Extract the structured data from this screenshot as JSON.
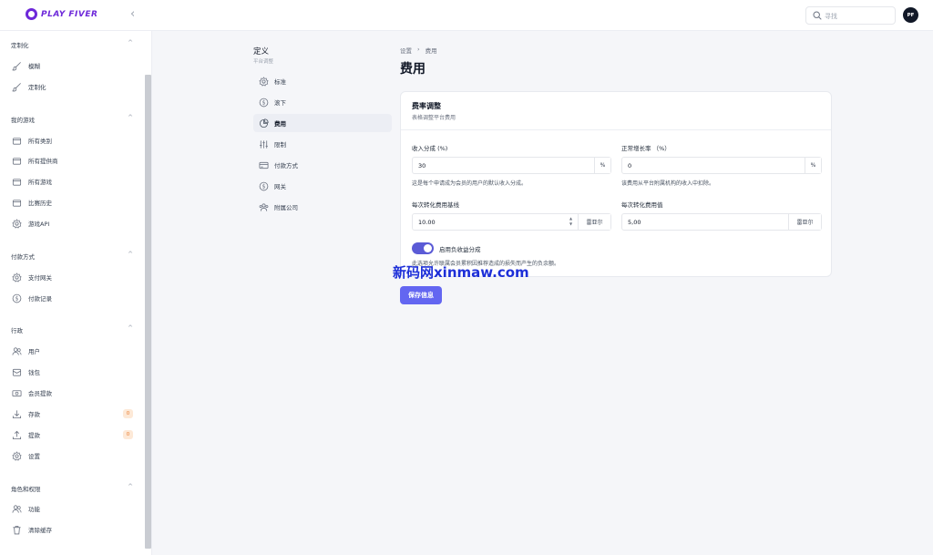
{
  "app": {
    "logo_text": "PLAY FIVER"
  },
  "header": {
    "search_placeholder": "寻找",
    "avatar_initials": "PF"
  },
  "sidebar": {
    "sections": [
      {
        "title": "定制化",
        "items": [
          {
            "label": "模糊",
            "icon": "brush-icon"
          },
          {
            "label": "定制化",
            "icon": "brush-icon"
          }
        ]
      },
      {
        "title": "我的游戏",
        "items": [
          {
            "label": "所有类别",
            "icon": "folder-icon"
          },
          {
            "label": "所有提供商",
            "icon": "folder-icon"
          },
          {
            "label": "所有游戏",
            "icon": "folder-icon"
          },
          {
            "label": "比赛历史",
            "icon": "folder-icon"
          },
          {
            "label": "游戏API",
            "icon": "gear-icon"
          }
        ]
      },
      {
        "title": "付款方式",
        "items": [
          {
            "label": "支付网关",
            "icon": "gear-icon"
          },
          {
            "label": "付款记录",
            "icon": "dollar-icon"
          }
        ]
      },
      {
        "title": "行政",
        "items": [
          {
            "label": "用户",
            "icon": "users-icon"
          },
          {
            "label": "钱包",
            "icon": "wallet-icon"
          },
          {
            "label": "会员提款",
            "icon": "cash-icon"
          },
          {
            "label": "存款",
            "icon": "download-icon",
            "badge": "0"
          },
          {
            "label": "提款",
            "icon": "upload-icon",
            "badge": "0"
          },
          {
            "label": "设置",
            "icon": "gear-icon"
          }
        ]
      },
      {
        "title": "角色和权限",
        "items": [
          {
            "label": "功能",
            "icon": "users-icon"
          },
          {
            "label": "清除缓存",
            "icon": "trash-icon"
          }
        ]
      }
    ]
  },
  "subnav": {
    "title": "定义",
    "subtitle": "平台调整",
    "items": [
      {
        "label": "标准",
        "icon": "gear-icon"
      },
      {
        "label": "滚下",
        "icon": "dollar-icon"
      },
      {
        "label": "费用",
        "icon": "pie-chart-icon",
        "active": true
      },
      {
        "label": "限制",
        "icon": "sliders-icon"
      },
      {
        "label": "付款方式",
        "icon": "card-icon"
      },
      {
        "label": "网关",
        "icon": "dollar-icon"
      },
      {
        "label": "附属公司",
        "icon": "users-icon"
      }
    ]
  },
  "breadcrumb": {
    "parent": "设置",
    "separator": "›",
    "current": "费用"
  },
  "page": {
    "title": "费用"
  },
  "card": {
    "title": "费率调整",
    "subtitle": "表格调整平台费用",
    "fields": {
      "revenue_share": {
        "label": "收入分成 (%)",
        "value": "30",
        "suffix": "%",
        "help": "这是每个申请成为会员的用户的默认收入分成。"
      },
      "growth_rate": {
        "label": "正常增长率 （%）",
        "value": "0",
        "suffix": "%",
        "help": "该费用从平台附属机构的收入中扣除。"
      },
      "cpa_baseline": {
        "label": "每次转化费用基线",
        "value": "10.00",
        "suffix": "雷亚尔"
      },
      "cpa_value": {
        "label": "每次转化费用值",
        "value": "5,00",
        "suffix": "雷亚尔"
      }
    },
    "toggle": {
      "label": "启用负收益分成",
      "on": true,
      "help": "此选项允许联属会员累积因推荐造成的损失而产生的负余额。"
    }
  },
  "actions": {
    "save_label": "保存信息"
  },
  "watermark": {
    "text": "新码网xinmaw.com"
  },
  "colors": {
    "accent": "#6366f1",
    "toggle": "#5b5bd6",
    "brand": "#6d28d9",
    "badge": "#ea7a2b",
    "watermark": "#1d2fd8"
  }
}
